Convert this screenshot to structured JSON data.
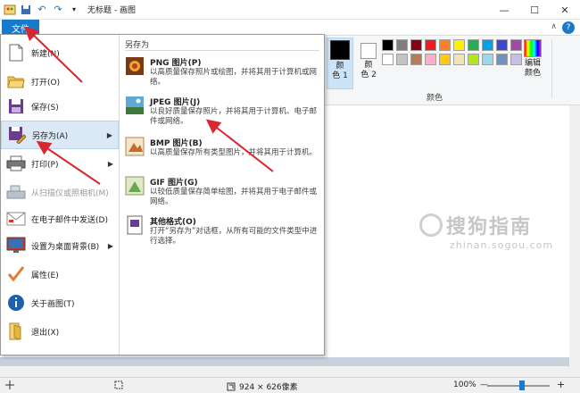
{
  "window": {
    "title": "无标题 - 画图",
    "minimize": "—",
    "maximize": "☐",
    "close": "✕"
  },
  "ribbon": {
    "file_tab": "文件",
    "collapse": "∧",
    "help": "?",
    "color1_label": "颜\n色 1",
    "color2_label": "颜\n色 2",
    "edit_colors_label": "编辑\n颜色",
    "group_label": "颜色",
    "palette": [
      "#000000",
      "#7f7f7f",
      "#880015",
      "#ed1c24",
      "#ff7f27",
      "#fff200",
      "#22b14c",
      "#00a2e8",
      "#3f48cc",
      "#a349a4",
      "#ffffff",
      "#c3c3c3",
      "#b97a57",
      "#ffaec9",
      "#ffc90e",
      "#efe4b0",
      "#b5e61d",
      "#99d9ea",
      "#7092be",
      "#c8bfe7"
    ]
  },
  "file_menu": {
    "items": [
      {
        "label": "新建(N)",
        "icon": "new-file-icon",
        "disabled": false,
        "submenu": false
      },
      {
        "label": "打开(O)",
        "icon": "open-folder-icon",
        "disabled": false,
        "submenu": false
      },
      {
        "label": "保存(S)",
        "icon": "save-disk-icon",
        "disabled": false,
        "submenu": false
      },
      {
        "label": "另存为(A)",
        "icon": "save-as-icon",
        "disabled": false,
        "submenu": true
      },
      {
        "label": "打印(P)",
        "icon": "printer-icon",
        "disabled": false,
        "submenu": true
      },
      {
        "label": "从扫描仪或照相机(M)",
        "icon": "scanner-icon",
        "disabled": true,
        "submenu": false
      },
      {
        "label": "在电子邮件中发送(D)",
        "icon": "email-icon",
        "disabled": false,
        "submenu": false
      },
      {
        "label": "设置为桌面背景(B)",
        "icon": "desktop-icon",
        "disabled": false,
        "submenu": true
      },
      {
        "label": "属性(E)",
        "icon": "checkmark-icon",
        "disabled": false,
        "submenu": false
      },
      {
        "label": "关于画图(T)",
        "icon": "info-icon",
        "disabled": false,
        "submenu": false
      },
      {
        "label": "退出(X)",
        "icon": "exit-icon",
        "disabled": false,
        "submenu": false
      }
    ],
    "submenu_title": "另存为",
    "submenu_items": [
      {
        "title": "PNG 图片(P)",
        "desc": "以高质量保存照片或绘图，并将其用于计算机或网络。"
      },
      {
        "title": "JPEG 图片(J)",
        "desc": "以良好质量保存照片，并将其用于计算机、电子邮件或网络。"
      },
      {
        "title": "BMP 图片(B)",
        "desc": "以高质量保存所有类型图片，并将其用于计算机。"
      },
      {
        "title": "GIF 图片(G)",
        "desc": "以较低质量保存简单绘图，并将其用于电子邮件或网络。"
      },
      {
        "title": "其他格式(O)",
        "desc": "打开“另存为”对话框，从所有可能的文件类型中进行选择。"
      }
    ]
  },
  "statusbar": {
    "dimensions": "924 × 626像素",
    "zoom": "100%",
    "zoom_out": "—",
    "zoom_in": "+"
  },
  "watermark": {
    "cn": "搜狗指南",
    "en": "zhinan.sogou.com"
  }
}
